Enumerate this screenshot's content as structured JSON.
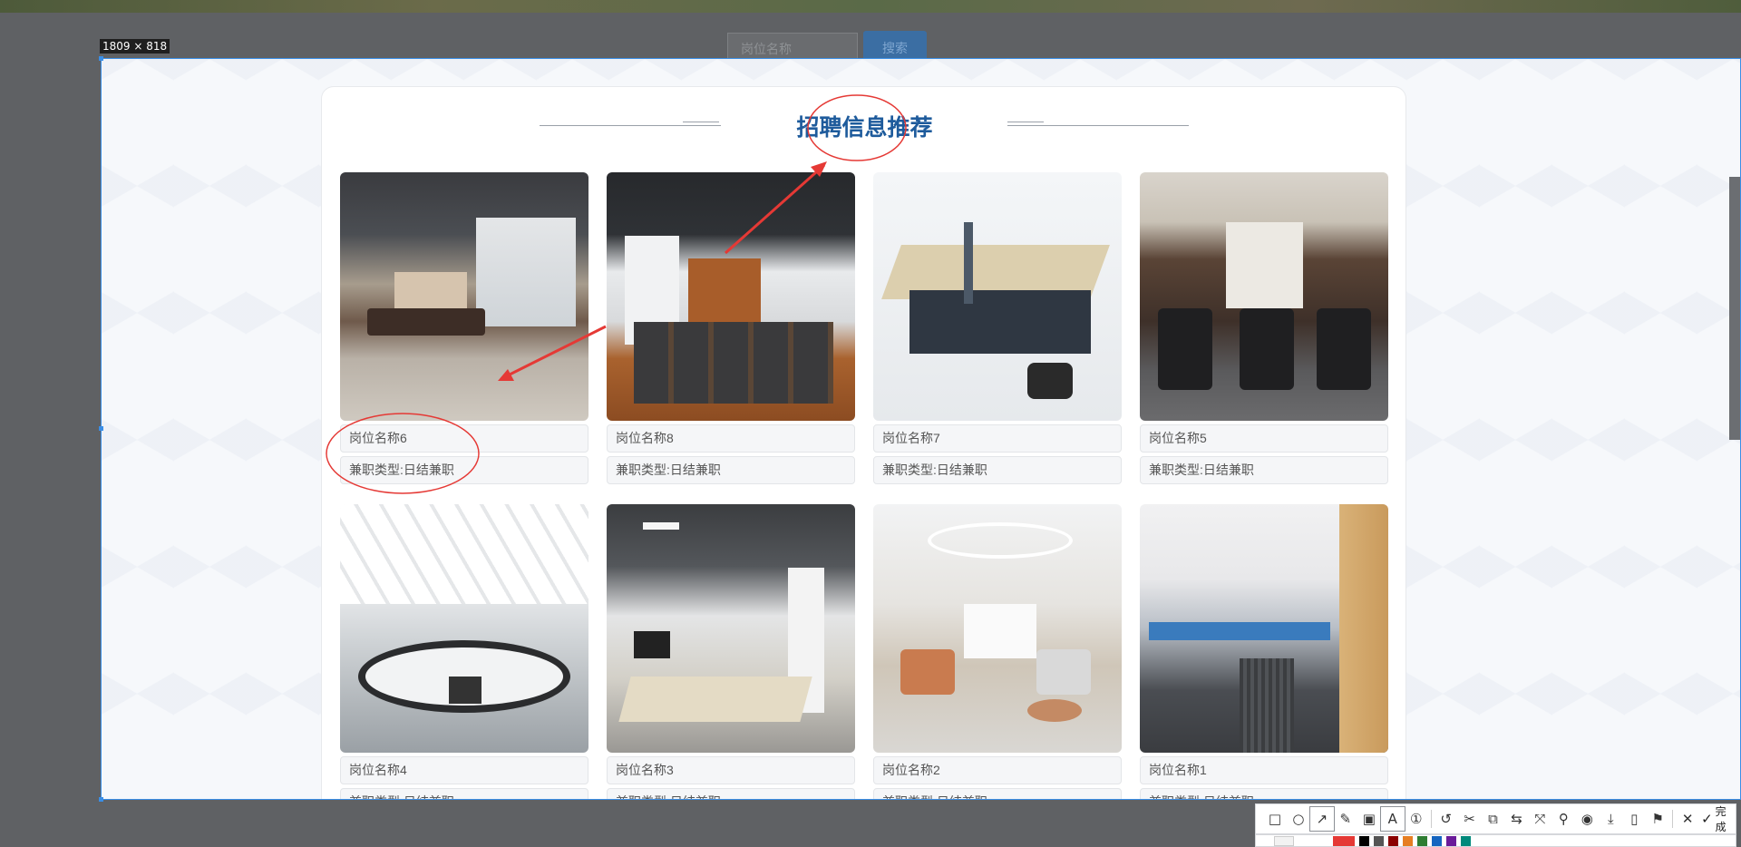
{
  "search": {
    "placeholder": "岗位名称",
    "button_label": "搜索"
  },
  "selection": {
    "size_label": "1809 × 818"
  },
  "section": {
    "title": "招聘信息推荐"
  },
  "cards": [
    {
      "name": "岗位名称6",
      "type": "兼职类型:日结兼职",
      "image": "loft-lounge-photo"
    },
    {
      "name": "岗位名称8",
      "type": "兼职类型:日结兼职",
      "image": "meeting-hall-photo"
    },
    {
      "name": "岗位名称7",
      "type": "兼职类型:日结兼职",
      "image": "office-cubicles-photo"
    },
    {
      "name": "岗位名称5",
      "type": "兼职类型:日结兼职",
      "image": "executive-office-photo"
    },
    {
      "name": "岗位名称4",
      "type": "兼职类型:日结兼职",
      "image": "conference-room-photo"
    },
    {
      "name": "岗位名称3",
      "type": "兼职类型:日结兼职",
      "image": "computer-office-photo"
    },
    {
      "name": "岗位名称2",
      "type": "兼职类型:日结兼职",
      "image": "reception-lounge-photo"
    },
    {
      "name": "岗位名称1",
      "type": "兼职类型:日结兼职",
      "image": "open-office-photo"
    }
  ],
  "toolbar": {
    "tools": [
      "rectangle-icon",
      "ellipse-icon",
      "arrow-icon",
      "pen-icon",
      "mosaic-icon",
      "text-icon",
      "serial-number-icon",
      "undo-icon",
      "redo-icon",
      "ocr-icon",
      "translate-icon",
      "long-screenshot-icon",
      "pin-icon",
      "record-icon",
      "save-icon",
      "copy-icon",
      "bookmark-icon",
      "close-icon"
    ],
    "done_label": "完成"
  },
  "colors": {
    "accent": "#3a8ee6",
    "title": "#1e5b9c",
    "annotation": "#e53935",
    "palette": [
      "#e53935",
      "#000000",
      "#555555",
      "#8b0000",
      "#e67e22",
      "#2e7d32",
      "#1565c0",
      "#6a1b9a",
      "#00897b"
    ]
  }
}
